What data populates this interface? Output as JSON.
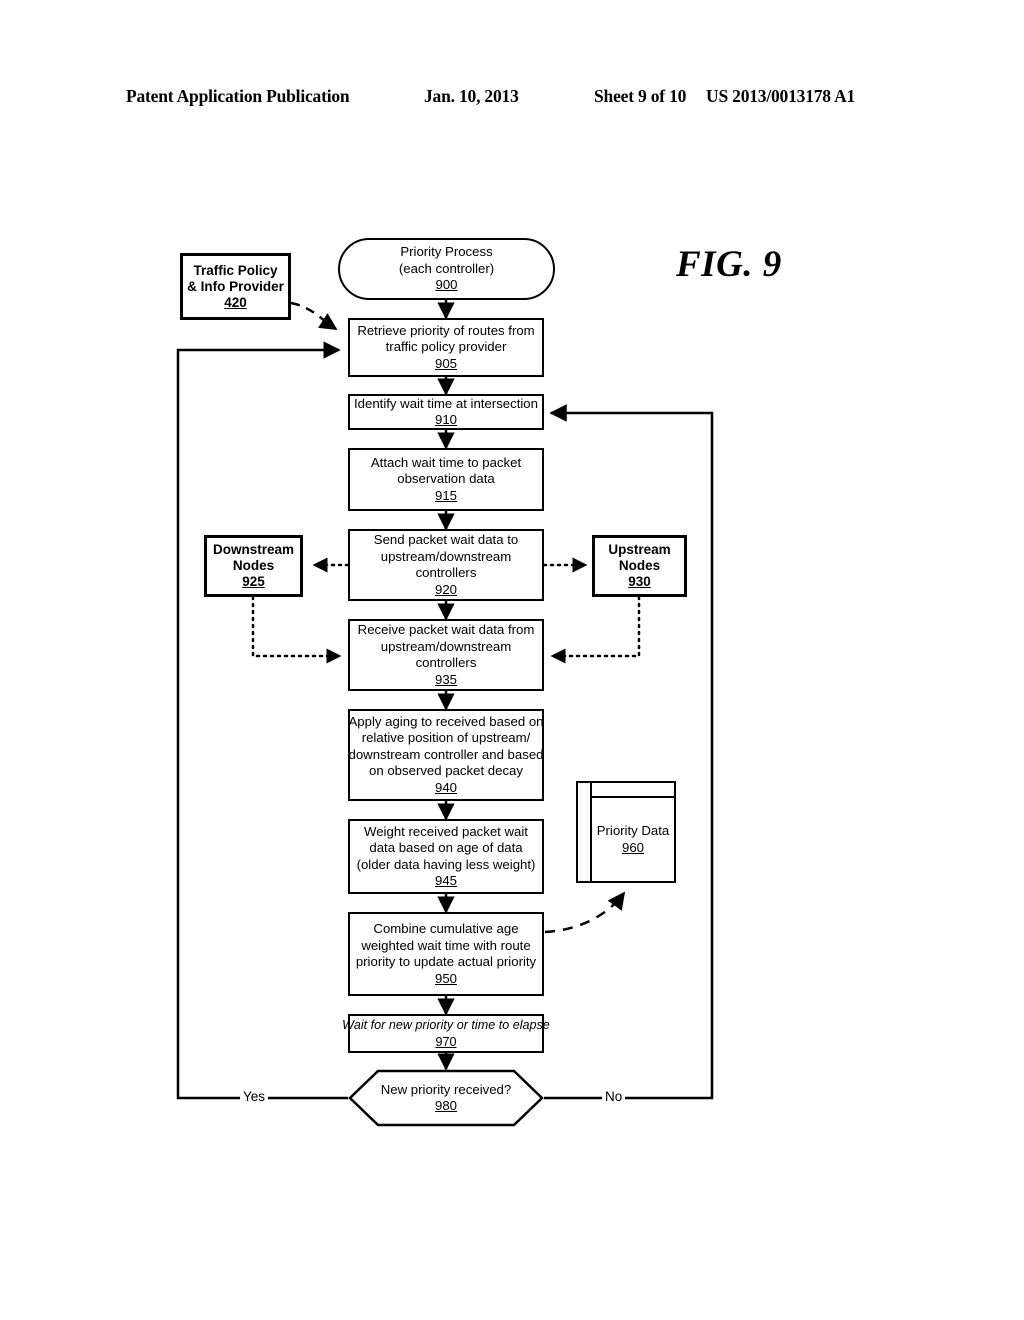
{
  "header": {
    "publication": "Patent Application Publication",
    "date": "Jan. 10, 2013",
    "sheet": "Sheet 9 of 10",
    "patent_number": "US 2013/0013178 A1"
  },
  "figure": {
    "label": "FIG. 9"
  },
  "nodes": {
    "traffic_policy": {
      "line1": "Traffic Policy",
      "line2": "& Info Provider",
      "ref": "420"
    },
    "start_900": {
      "line1": "Priority Process",
      "line2": "(each controller)",
      "ref": "900"
    },
    "step_905": {
      "line1": "Retrieve priority of routes from",
      "line2": "traffic policy provider",
      "ref": "905"
    },
    "step_910": {
      "line1": "Identify wait time at intersection",
      "ref": "910"
    },
    "step_915": {
      "line1": "Attach wait time to packet",
      "line2": "observation data",
      "ref": "915"
    },
    "step_920": {
      "line1": "Send packet wait data to",
      "line2": "upstream/downstream",
      "line3": "controllers",
      "ref": "920"
    },
    "downstream_925": {
      "line1": "Downstream",
      "line2": "Nodes",
      "ref": "925"
    },
    "upstream_930": {
      "line1": "Upstream",
      "line2": "Nodes",
      "ref": "930"
    },
    "step_935": {
      "line1": "Receive packet wait data from",
      "line2": "upstream/downstream",
      "line3": "controllers",
      "ref": "935"
    },
    "step_940": {
      "line1": "Apply aging to received based on",
      "line2": "relative position of upstream/",
      "line3": "downstream controller and based",
      "line4": "on observed packet decay",
      "ref": "940"
    },
    "step_945": {
      "line1": "Weight received packet wait",
      "line2": "data based on age of data",
      "line3": "(older data having less weight)",
      "ref": "945"
    },
    "step_950": {
      "line1": "Combine cumulative age",
      "line2": "weighted wait time with route",
      "line3": "priority to update actual priority",
      "ref": "950"
    },
    "store_960": {
      "line1": "Priority Data",
      "ref": "960"
    },
    "step_970": {
      "line1": "Wait for new priority or time to elapse",
      "ref": "970"
    },
    "decision_980": {
      "line1": "New priority received?",
      "ref": "980"
    }
  },
  "branches": {
    "yes": "Yes",
    "no": "No"
  },
  "colors": {
    "ink": "#000000",
    "paper": "#ffffff"
  }
}
